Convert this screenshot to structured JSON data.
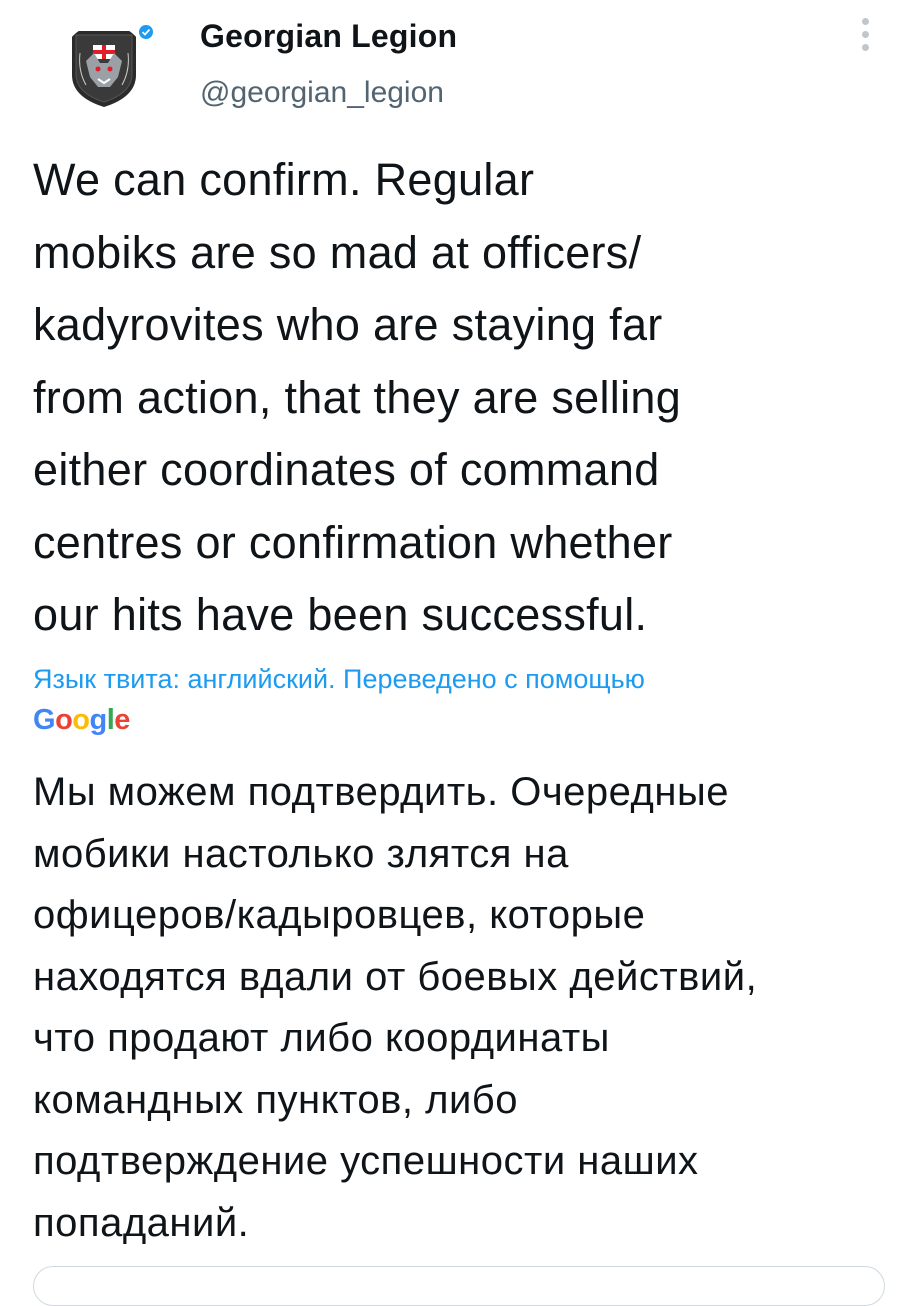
{
  "account": {
    "name": "Georgian Legion",
    "handle": "@georgian_legion",
    "avatar_icon": "wolf-emblem-icon",
    "verified_icon": "verified-badge-icon",
    "accent_color": "#1d9bf0"
  },
  "tweet": {
    "lines": [
      "We can confirm. Regular",
      "mobiks are so mad at officers/",
      "kadyrovites who are staying far",
      "from action, that they are selling",
      "either coordinates of command",
      "centres or confirmation whether",
      "our hits have been successful."
    ]
  },
  "translation": {
    "notice": "Язык твита: английский. Переведено с помощью",
    "provider": "Google",
    "lines": [
      "Мы можем подтвердить. Очередные",
      "мобики настолько злятся на",
      "офицеров/кадыровцев, которые",
      "находятся вдали от боевых действий,",
      "что продают либо координаты",
      "командных пунктов, либо",
      "подтверждение успешности наших",
      "попаданий."
    ]
  }
}
